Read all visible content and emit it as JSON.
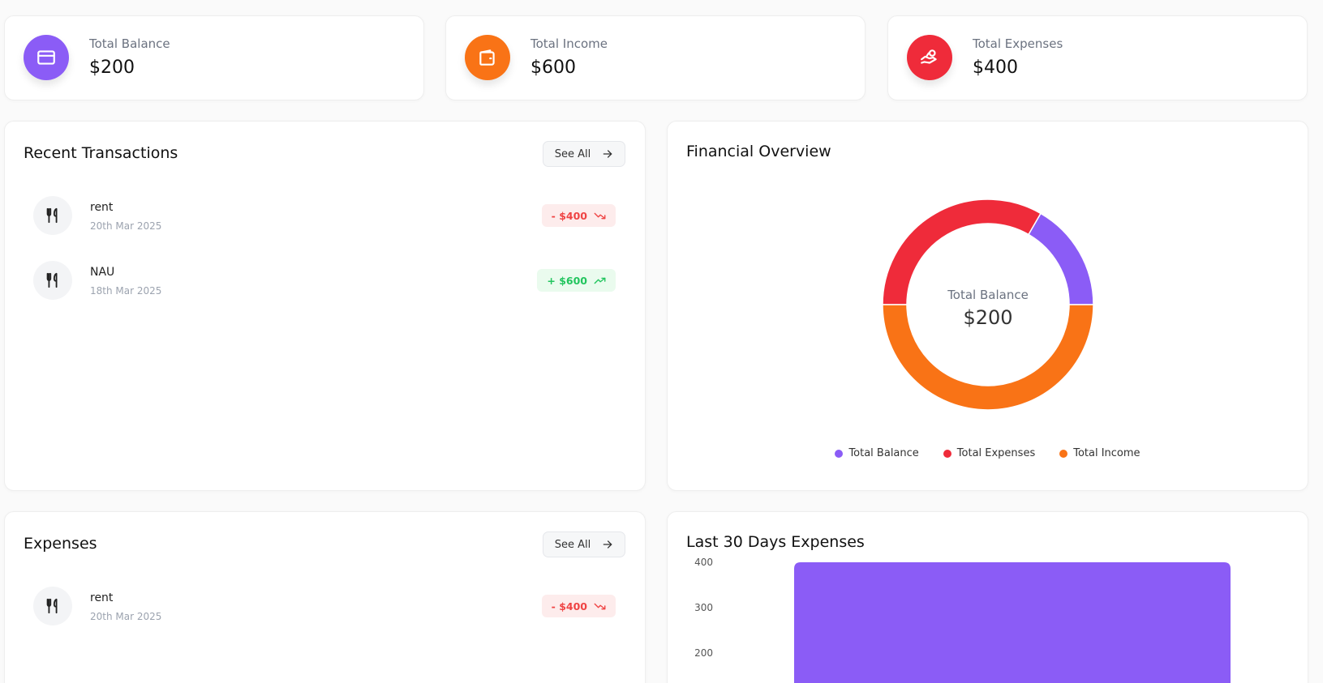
{
  "summary": [
    {
      "label": "Total Balance",
      "value": "$200",
      "color": "#8b5cf6",
      "icon": "credit-card-icon"
    },
    {
      "label": "Total Income",
      "value": "$600",
      "color": "#f97316",
      "icon": "wallet-icon"
    },
    {
      "label": "Total Expenses",
      "value": "$400",
      "color": "#ef2b3a",
      "icon": "hand-coins-icon"
    }
  ],
  "recent": {
    "title": "Recent Transactions",
    "see_all": "See All",
    "items": [
      {
        "name": "rent",
        "date": "20th Mar 2025",
        "amount": "- $400",
        "type": "expense",
        "icon": "utensils-icon"
      },
      {
        "name": "NAU",
        "date": "18th Mar 2025",
        "amount": "+ $600",
        "type": "income",
        "icon": "utensils-icon"
      }
    ]
  },
  "overview": {
    "title": "Financial Overview",
    "center_label": "Total Balance",
    "center_value": "$200",
    "legend": [
      "Total Balance",
      "Total Expenses",
      "Total Income"
    ]
  },
  "expenses": {
    "title": "Expenses",
    "see_all": "See All",
    "items": [
      {
        "name": "rent",
        "date": "20th Mar 2025",
        "amount": "- $400",
        "type": "expense",
        "icon": "utensils-icon"
      }
    ]
  },
  "last30": {
    "title": "Last 30 Days Expenses"
  },
  "chart_data": [
    {
      "type": "pie",
      "categories": [
        "Total Balance",
        "Total Expenses",
        "Total Income"
      ],
      "values": [
        200,
        400,
        600
      ],
      "colors": [
        "#8b5cf6",
        "#ef2b3a",
        "#f97316"
      ],
      "legend": "bottom"
    },
    {
      "type": "bar",
      "categories": [
        ""
      ],
      "values": [
        400
      ],
      "yticks": [
        400,
        300,
        200
      ],
      "colors": [
        "#8b5cf6"
      ]
    }
  ],
  "colors": {
    "expense": "#ef4444",
    "income": "#22c55e",
    "accent": "#8b5cf6"
  }
}
